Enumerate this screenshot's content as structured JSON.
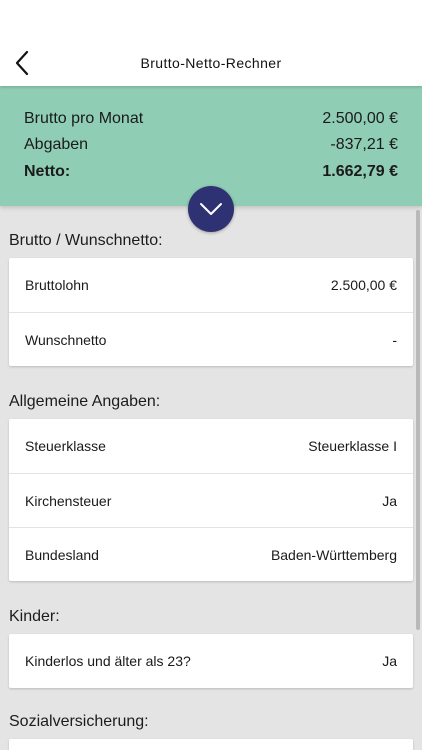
{
  "header": {
    "title": "Brutto-Netto-Rechner"
  },
  "summary": {
    "brutto_label": "Brutto pro Monat",
    "brutto_value": "2.500,00 €",
    "abgaben_label": "Abgaben",
    "abgaben_value": "-837,21 €",
    "netto_label": "Netto:",
    "netto_value": "1.662,79 €",
    "colors": {
      "background": "#8fcdb4",
      "expand_button": "#2f3272"
    }
  },
  "sections": {
    "brutto": {
      "title": "Brutto / Wunschnetto:",
      "rows": [
        {
          "label": "Bruttolohn",
          "value": "2.500,00 €"
        },
        {
          "label": "Wunschnetto",
          "value": "-"
        }
      ]
    },
    "allgemein": {
      "title": "Allgemeine Angaben:",
      "rows": [
        {
          "label": "Steuerklasse",
          "value": "Steuerklasse I"
        },
        {
          "label": "Kirchensteuer",
          "value": "Ja"
        },
        {
          "label": "Bundesland",
          "value": "Baden-Württemberg"
        }
      ]
    },
    "kinder": {
      "title": "Kinder:",
      "rows": [
        {
          "label": "Kinderlos und älter als 23?",
          "value": "Ja"
        }
      ]
    },
    "sozial": {
      "title": "Sozialversicherung:"
    }
  },
  "icons": {
    "back": "chevron-left-icon",
    "expand": "chevron-down-icon"
  }
}
